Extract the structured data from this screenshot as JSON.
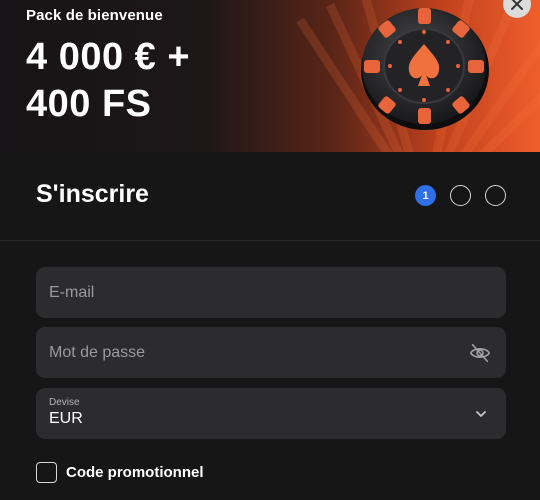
{
  "banner": {
    "subtitle": "Pack de bienvenue",
    "title_line1": "4 000 € +",
    "title_line2": "400 FS"
  },
  "close": {
    "icon": "close-icon"
  },
  "signup": {
    "title": "S'inscrire",
    "steps": [
      {
        "label": "1",
        "active": true
      },
      {
        "label": "",
        "active": false
      },
      {
        "label": "",
        "active": false
      }
    ]
  },
  "form": {
    "email": {
      "placeholder": "E-mail",
      "value": ""
    },
    "password": {
      "placeholder": "Mot de passe",
      "value": "",
      "icon": "eye-off-icon"
    },
    "currency": {
      "label": "Devise",
      "value": "EUR",
      "icon": "chevron-down-icon"
    },
    "promo": {
      "label": "Code promotionnel",
      "checked": false
    }
  },
  "colors": {
    "accent": "#2f6fe8",
    "banner_orange": "#ee5e2c",
    "field_bg": "#2c2c2e",
    "background": "#161617"
  }
}
